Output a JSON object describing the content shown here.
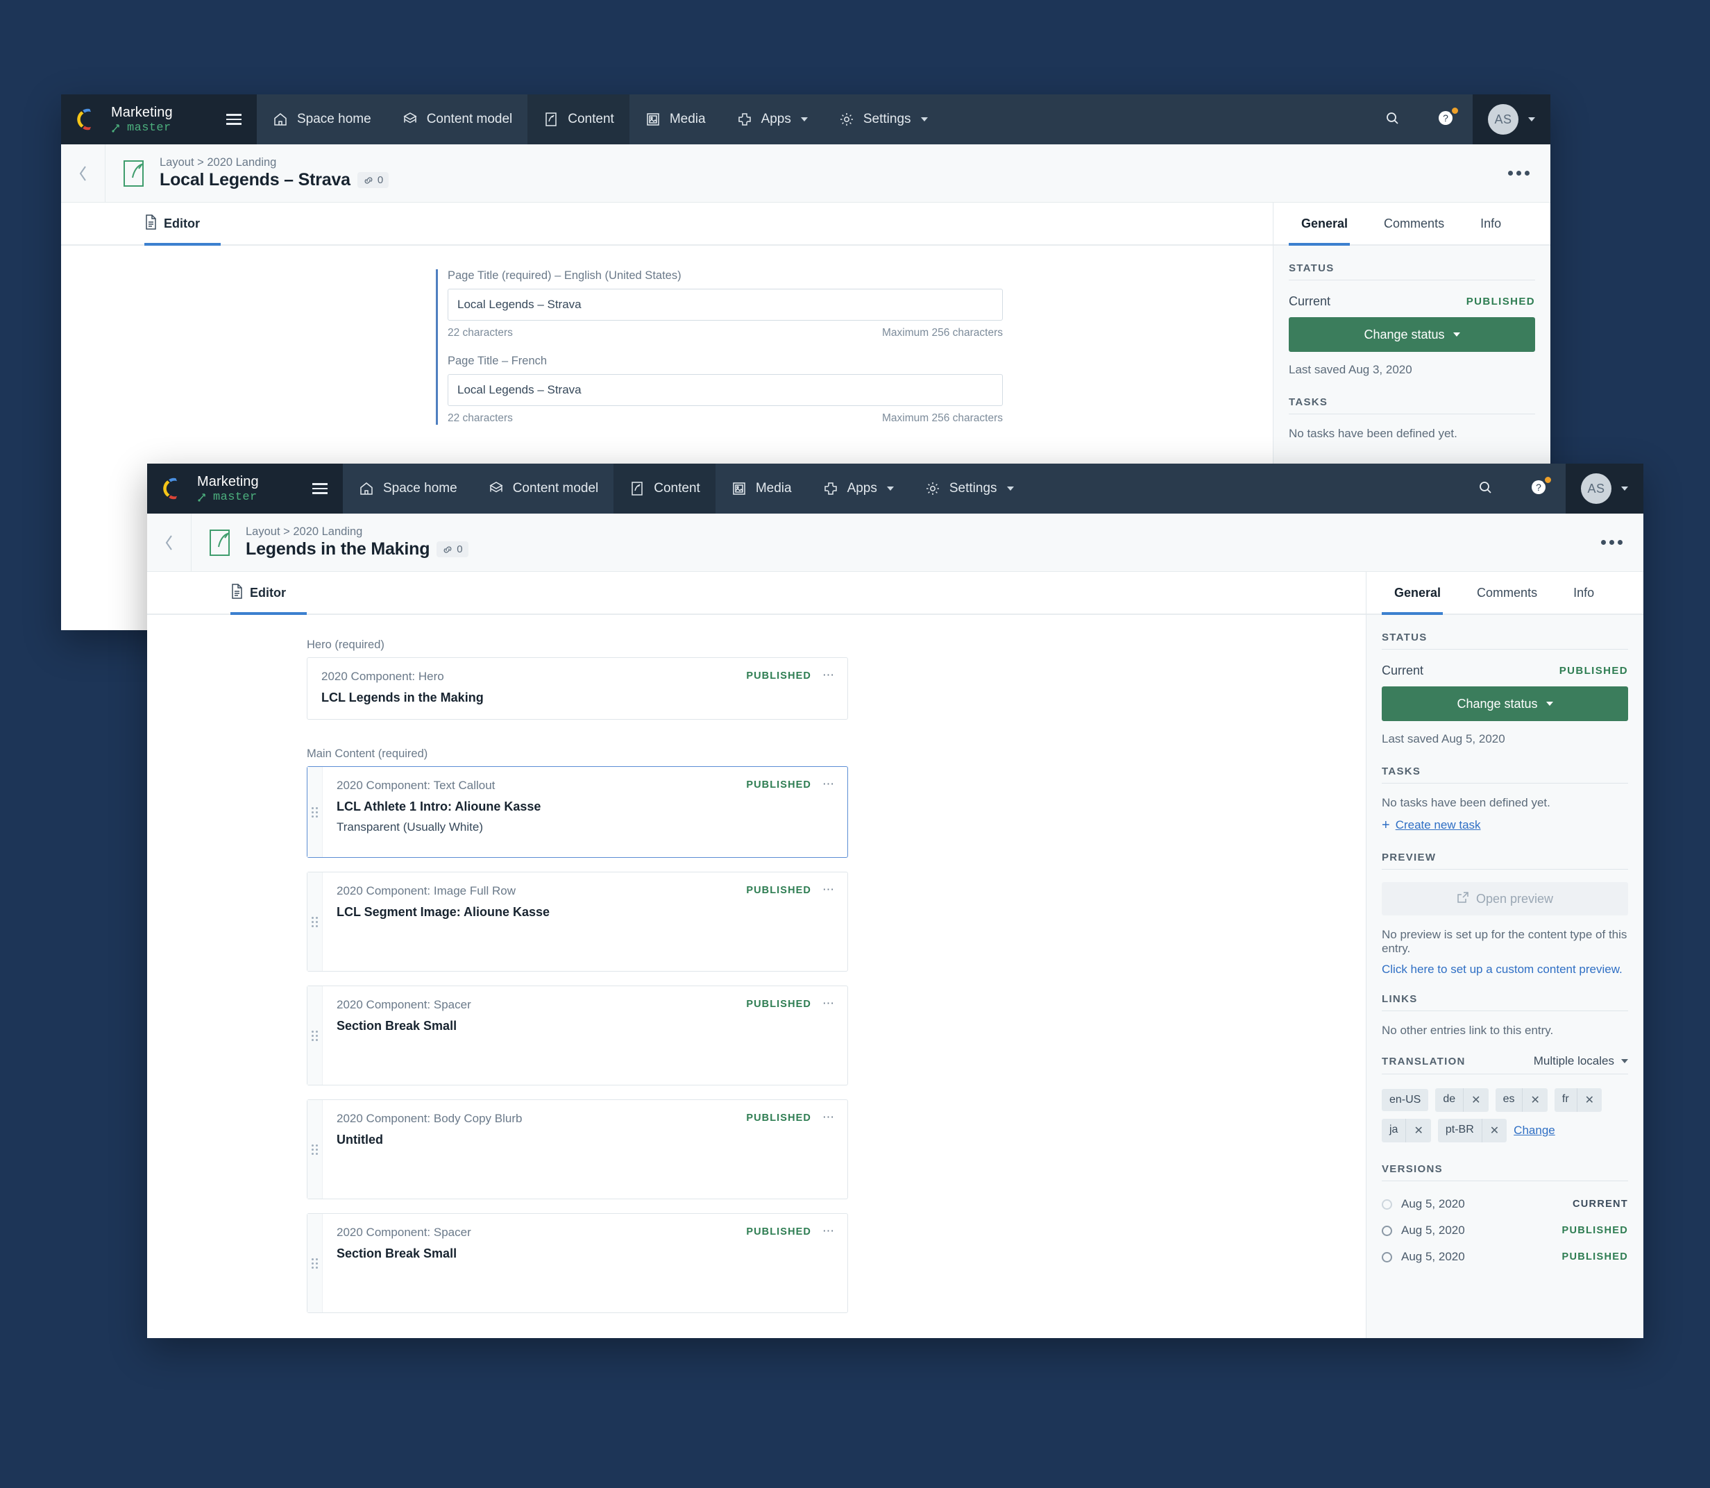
{
  "app": {
    "space_name": "Marketing",
    "environment": "master",
    "nav": [
      {
        "label": "Space home",
        "icon": "home-icon",
        "active": false,
        "caret": false
      },
      {
        "label": "Content model",
        "icon": "content-model-icon",
        "active": false,
        "caret": false
      },
      {
        "label": "Content",
        "icon": "content-icon",
        "active": true,
        "caret": false
      },
      {
        "label": "Media",
        "icon": "media-icon",
        "active": false,
        "caret": false
      },
      {
        "label": "Apps",
        "icon": "apps-icon",
        "active": false,
        "caret": true
      },
      {
        "label": "Settings",
        "icon": "settings-icon",
        "active": false,
        "caret": true
      }
    ],
    "avatar_initials": "AS"
  },
  "window_back": {
    "breadcrumb": "Layout > 2020 Landing",
    "title": "Local Legends – Strava",
    "link_count": "0",
    "tab_editor": "Editor",
    "fields": [
      {
        "label": "Page Title (required) – English (United States)",
        "value": "Local Legends – Strava",
        "placeholder": "",
        "count": "22 characters",
        "max": "Maximum 256 characters"
      },
      {
        "label": "Page Title – French",
        "value": "Local Legends – Strava",
        "placeholder": "",
        "count": "22 characters",
        "max": "Maximum 256 characters"
      }
    ],
    "sidebar": {
      "tabs": [
        {
          "label": "General",
          "active": true
        },
        {
          "label": "Comments",
          "active": false
        },
        {
          "label": "Info",
          "active": false
        }
      ],
      "status_heading": "STATUS",
      "current_label": "Current",
      "current_status": "PUBLISHED",
      "change_status_label": "Change status",
      "last_saved": "Last saved Aug 3, 2020",
      "tasks_heading": "TASKS",
      "tasks_empty": "No tasks have been defined yet."
    }
  },
  "window_front": {
    "breadcrumb": "Layout > 2020 Landing",
    "title": "Legends in the Making",
    "link_count": "0",
    "tab_editor": "Editor",
    "sections": [
      {
        "label": "Hero (required)",
        "entries": [
          {
            "type": "2020 Component: Hero",
            "title": "LCL Legends in the Making",
            "subtitle": "",
            "status": "PUBLISHED",
            "selected": false,
            "has_drag": false,
            "height": "hero"
          }
        ]
      },
      {
        "label": "Main Content (required)",
        "entries": [
          {
            "type": "2020 Component: Text Callout",
            "title": "LCL Athlete 1 Intro: Alioune Kasse",
            "subtitle": "Transparent (Usually White)",
            "status": "PUBLISHED",
            "selected": true,
            "has_drag": true,
            "height": "sel"
          },
          {
            "type": "2020 Component: Image Full Row",
            "title": "LCL Segment Image: Alioune Kasse",
            "subtitle": "",
            "status": "PUBLISHED",
            "selected": false,
            "has_drag": true,
            "height": "tall"
          },
          {
            "type": "2020 Component: Spacer",
            "title": "Section Break Small",
            "subtitle": "",
            "status": "PUBLISHED",
            "selected": false,
            "has_drag": true,
            "height": "tall"
          },
          {
            "type": "2020 Component: Body Copy Blurb",
            "title": "Untitled",
            "subtitle": "",
            "status": "PUBLISHED",
            "selected": false,
            "has_drag": true,
            "height": "tall"
          },
          {
            "type": "2020 Component: Spacer",
            "title": "Section Break Small",
            "subtitle": "",
            "status": "PUBLISHED",
            "selected": false,
            "has_drag": true,
            "height": "tall"
          }
        ]
      }
    ],
    "sidebar": {
      "tabs": [
        {
          "label": "General",
          "active": true
        },
        {
          "label": "Comments",
          "active": false
        },
        {
          "label": "Info",
          "active": false
        }
      ],
      "status_heading": "STATUS",
      "current_label": "Current",
      "current_status": "PUBLISHED",
      "change_status_label": "Change status",
      "last_saved": "Last saved Aug 5, 2020",
      "tasks_heading": "TASKS",
      "tasks_empty": "No tasks have been defined yet.",
      "create_task_label": "Create new task",
      "preview_heading": "PREVIEW",
      "open_preview_label": "Open preview",
      "preview_empty": "No preview is set up for the content type of this entry.",
      "preview_link": "Click here to set up a custom content preview.",
      "links_heading": "LINKS",
      "links_empty": "No other entries link to this entry.",
      "translation_heading": "TRANSLATION",
      "translation_selector": "Multiple locales",
      "locales": [
        {
          "code": "en-US",
          "removable": false
        },
        {
          "code": "de",
          "removable": true
        },
        {
          "code": "es",
          "removable": true
        },
        {
          "code": "fr",
          "removable": true
        },
        {
          "code": "ja",
          "removable": true
        },
        {
          "code": "pt-BR",
          "removable": true
        }
      ],
      "change_locales_label": "Change",
      "versions_heading": "VERSIONS",
      "versions": [
        {
          "date": "Aug 5, 2020",
          "tag": "CURRENT",
          "tag_kind": "current",
          "selected": true
        },
        {
          "date": "Aug 5, 2020",
          "tag": "PUBLISHED",
          "tag_kind": "published",
          "selected": false
        },
        {
          "date": "Aug 5, 2020",
          "tag": "PUBLISHED",
          "tag_kind": "published",
          "selected": false
        }
      ]
    }
  },
  "colors": {
    "background": "#1d3557",
    "nav_bg": "#2a3b4d",
    "nav_space_bg": "#192532",
    "accent_blue": "#3c80cf",
    "green_button": "#3b7d5c",
    "published_green": "#2e7d52",
    "link_blue": "#2f6fc4"
  }
}
